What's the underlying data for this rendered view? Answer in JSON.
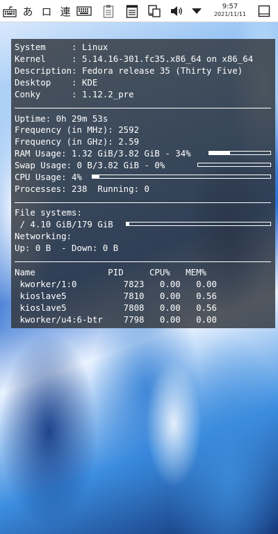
{
  "taskbar": {
    "items": [
      {
        "name": "keyboard-layout-icon",
        "glyph": ""
      },
      {
        "name": "input-hiragana-indicator",
        "label": "あ"
      },
      {
        "name": "input-square-indicator",
        "label": "ロ"
      },
      {
        "name": "input-mode-indicator",
        "label": "連"
      },
      {
        "name": "virtual-keyboard-icon",
        "glyph": ""
      },
      {
        "name": "clipboard-icon",
        "glyph": ""
      },
      {
        "name": "notes-icon",
        "glyph": ""
      },
      {
        "name": "network-icon",
        "glyph": ""
      },
      {
        "name": "volume-icon",
        "glyph": ""
      },
      {
        "name": "tray-expand-icon",
        "glyph": ""
      }
    ],
    "clock": {
      "time": "9:57",
      "date": "2021/11/11"
    }
  },
  "conky": {
    "system": [
      {
        "key": "System     : ",
        "value": "Linux"
      },
      {
        "key": "Kernel     : ",
        "value": "5.14.16-301.fc35.x86_64 on x86_64"
      },
      {
        "key": "Description: ",
        "value": "Fedora release 35 (Thirty Five)"
      },
      {
        "key": "Desktop    : ",
        "value": "KDE"
      },
      {
        "key": "Conky      : ",
        "value": "1.12.2_pre"
      }
    ],
    "uptime": "Uptime: 0h 29m 53s",
    "freq_mhz": "Frequency (in MHz): 2592",
    "freq_ghz": "Frequency (in GHz): 2.59",
    "ram": {
      "text": "RAM Usage: 1.32 GiB/3.82 GiB - 34%",
      "percent": 34
    },
    "swap": {
      "text": "Swap Usage: 0 B/3.82 GiB - 0%",
      "percent": 0
    },
    "cpu": {
      "text": "CPU Usage: 4%",
      "percent": 4
    },
    "processes": "Processes: 238  Running: 0",
    "fs_title": "File systems:",
    "fs_root": {
      "text": " / 4.10 GiB/179 GiB",
      "percent": 2
    },
    "net_title": "Networking:",
    "net_line": "Up: 0 B  - Down: 0 B",
    "proc_header": "Name              PID     CPU%   MEM%",
    "processes_table": [
      {
        "line": " kworker/1:0         7823   0.00   0.00"
      },
      {
        "line": " kioslave5           7810   0.00   0.56"
      },
      {
        "line": " kioslave5           7808   0.00   0.56"
      },
      {
        "line": " kworker/u4:6-btr    7798   0.00   0.00"
      }
    ]
  }
}
